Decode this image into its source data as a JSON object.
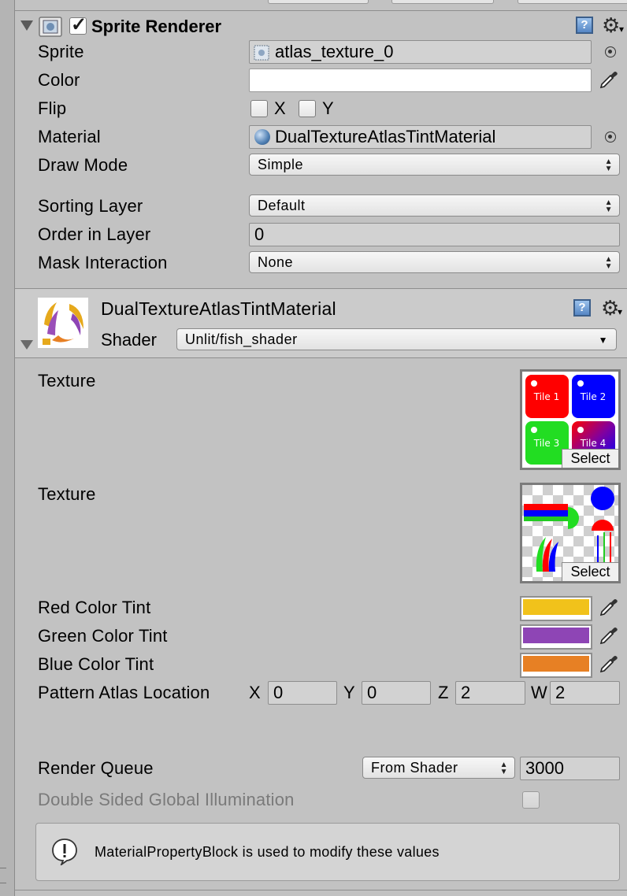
{
  "sprite_renderer": {
    "title": "Sprite Renderer",
    "enabled": true,
    "sprite_label": "Sprite",
    "sprite_value": "atlas_texture_0",
    "color_label": "Color",
    "color_value": "#ffffff",
    "flip_label": "Flip",
    "flip_x_label": "X",
    "flip_y_label": "Y",
    "material_label": "Material",
    "material_value": "DualTextureAtlasTintMaterial",
    "draw_mode_label": "Draw Mode",
    "draw_mode_value": "Simple",
    "sorting_layer_label": "Sorting Layer",
    "sorting_layer_value": "Default",
    "order_label": "Order in Layer",
    "order_value": "0",
    "mask_label": "Mask Interaction",
    "mask_value": "None"
  },
  "material": {
    "name": "DualTextureAtlasTintMaterial",
    "shader_label": "Shader",
    "shader_value": "Unlit/fish_shader",
    "texture1_label": "Texture",
    "texture1_tiles": [
      "Tile 1",
      "Tile 2",
      "Tile 3",
      "Tile 4"
    ],
    "texture2_label": "Texture",
    "select_label": "Select",
    "red_tint_label": "Red Color Tint",
    "red_tint_color": "#f1c21b",
    "green_tint_label": "Green Color Tint",
    "green_tint_color": "#8e45b5",
    "blue_tint_label": "Blue Color Tint",
    "blue_tint_color": "#e78024",
    "pattern_label": "Pattern Atlas Location",
    "pattern_x_label": "X",
    "pattern_x": "0",
    "pattern_y_label": "Y",
    "pattern_y": "0",
    "pattern_z_label": "Z",
    "pattern_z": "2",
    "pattern_w_label": "W",
    "pattern_w": "2",
    "render_queue_label": "Render Queue",
    "render_queue_mode": "From Shader",
    "render_queue_value": "3000",
    "double_sided_label": "Double Sided Global Illumination",
    "help_text": "MaterialPropertyBlock is used to modify these values"
  },
  "icons": {
    "help": "help-icon",
    "settings": "gear-icon",
    "picker": "eyedropper-icon",
    "object_picker": "object-picker-icon",
    "info": "info-icon"
  }
}
